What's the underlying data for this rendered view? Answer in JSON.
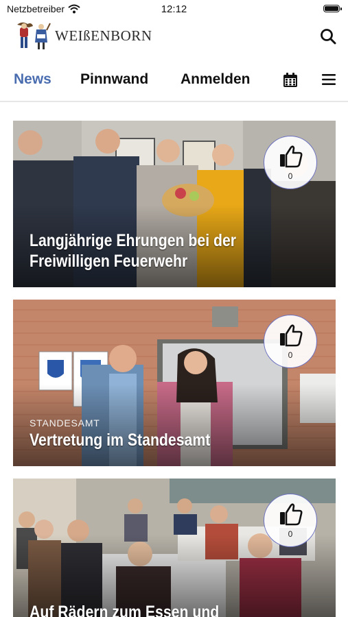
{
  "status_bar": {
    "carrier": "Netzbetreiber",
    "time": "12:12"
  },
  "header": {
    "app_name": "WEIßENBORN"
  },
  "nav": {
    "tabs": [
      {
        "label": "News",
        "active": true
      },
      {
        "label": "Pinnwand",
        "active": false
      },
      {
        "label": "Anmelden",
        "active": false
      }
    ],
    "icons": [
      "calendar-icon",
      "menu-icon"
    ]
  },
  "colors": {
    "accent": "#4a6db0",
    "like_ring": "#6a6fc0"
  },
  "news": [
    {
      "category": "",
      "title_line1": "Langjährige Ehrungen bei der",
      "title_line2": "Freiwilligen Feuerwehr",
      "likes": "0"
    },
    {
      "category": "STANDESAMT",
      "title_line1": "Vertretung im Standesamt",
      "title_line2": "",
      "likes": "0"
    },
    {
      "category": "",
      "title_line1": "Auf Rädern zum Essen und Einkaufen",
      "title_line2": "",
      "likes": "0"
    }
  ]
}
